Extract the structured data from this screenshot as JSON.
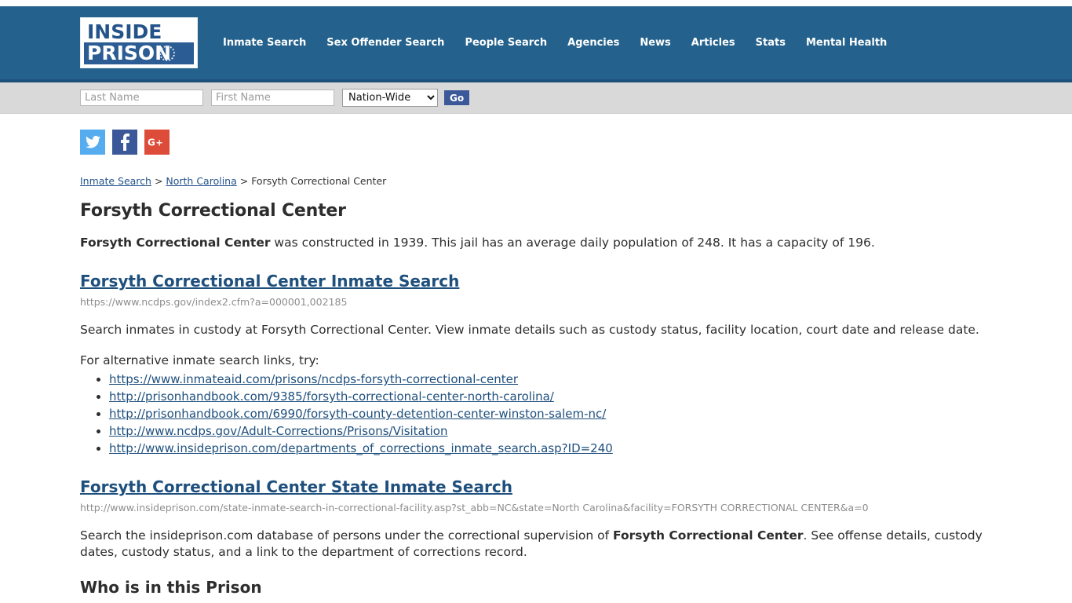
{
  "brand": {
    "logo_line1": "INSIDE",
    "logo_line2": "PRISON",
    "header_bg": "#24628d",
    "accent_link": "#1e4f7d"
  },
  "nav": {
    "items": [
      {
        "label": "Inmate Search"
      },
      {
        "label": "Sex Offender Search"
      },
      {
        "label": "People Search"
      },
      {
        "label": "Agencies"
      },
      {
        "label": "News"
      },
      {
        "label": "Articles"
      },
      {
        "label": "Stats"
      },
      {
        "label": "Mental Health"
      }
    ]
  },
  "search": {
    "last_name_placeholder": "Last Name",
    "last_name_value": "",
    "first_name_placeholder": "First Name",
    "first_name_value": "",
    "scope_selected": "Nation-Wide",
    "scope_options": [
      "Nation-Wide"
    ],
    "go_label": "Go"
  },
  "social": {
    "twitter_label": "Twitter",
    "facebook_label": "Facebook",
    "google_label": "G+"
  },
  "breadcrumb": {
    "item1": "Inmate Search",
    "sep1": " > ",
    "item2": "North Carolina",
    "sep2": " > ",
    "current": "Forsyth Correctional Center"
  },
  "page": {
    "title": "Forsyth Correctional Center",
    "intro_bold": "Forsyth Correctional Center",
    "intro_rest": " was constructed in 1939. This jail has an average daily population of 248. It has a capacity of 196."
  },
  "section1": {
    "heading": "Forsyth Correctional Center Inmate Search",
    "url": "https://www.ncdps.gov/index2.cfm?a=000001,002185",
    "description": "Search inmates in custody at Forsyth Correctional Center. View inmate details such as custody status, facility location, court date and release date.",
    "alt_intro": "For alternative inmate search links, try:",
    "alt_links": [
      "https://www.inmateaid.com/prisons/ncdps-forsyth-correctional-center",
      "http://prisonhandbook.com/9385/forsyth-correctional-center-north-carolina/",
      "http://prisonhandbook.com/6990/forsyth-county-detention-center-winston-salem-nc/",
      "http://www.ncdps.gov/Adult-Corrections/Prisons/Visitation",
      "http://www.insideprison.com/departments_of_corrections_inmate_search.asp?ID=240"
    ]
  },
  "section2": {
    "heading": "Forsyth Correctional Center State Inmate Search",
    "url": "http://www.insideprison.com/state-inmate-search-in-correctional-facility.asp?st_abb=NC&state=North Carolina&facility=FORSYTH CORRECTIONAL CENTER&a=0",
    "desc_part1": "Search the insideprison.com database of persons under the correctional supervision of ",
    "desc_bold": "Forsyth Correctional Center",
    "desc_part2": ". See offense details, custody dates, custody status, and a link to the department of corrections record."
  },
  "section3": {
    "heading": "Who is in this Prison"
  }
}
